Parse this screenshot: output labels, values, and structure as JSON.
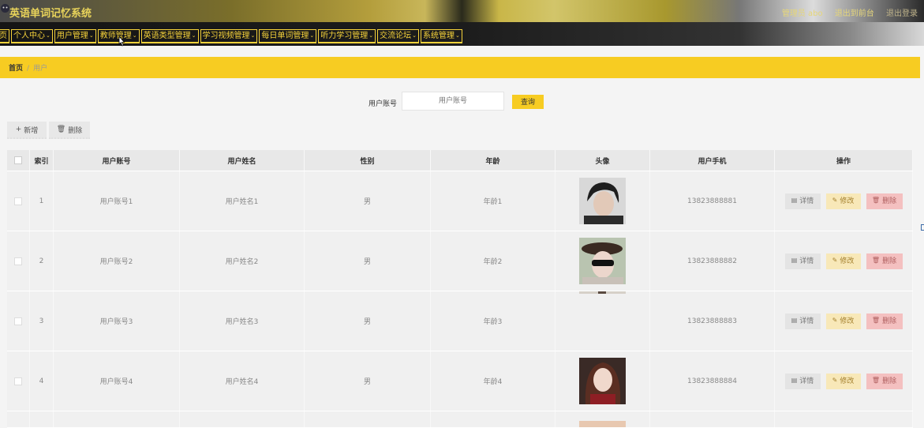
{
  "header": {
    "title": "英语单词记忆系统",
    "admin_label": "管理员 abo",
    "back_label": "退出到前台",
    "logout_label": "退出登录",
    "logo_icon": "panther-logo-icon"
  },
  "nav": {
    "items": [
      "页",
      "个人中心",
      "用户管理",
      "教师管理",
      "英语类型管理",
      "学习视频管理",
      "每日单词管理",
      "听力学习管理",
      "交流论坛",
      "系统管理"
    ],
    "caret_icon": "chevron-down-icon"
  },
  "breadcrumb": {
    "home": "首页",
    "separator": "/",
    "current": "用户"
  },
  "search": {
    "label": "用户账号",
    "placeholder": "用户账号",
    "button": "查询"
  },
  "toolbar": {
    "add": "新增",
    "delete": "删除"
  },
  "table": {
    "headers": [
      "索引",
      "用户账号",
      "用户姓名",
      "性别",
      "年龄",
      "头像",
      "用户手机",
      "操作"
    ],
    "rows": [
      {
        "index": "1",
        "account": "用户账号1",
        "name": "用户姓名1",
        "sex": "男",
        "age": "年龄1",
        "phone": "13823888881"
      },
      {
        "index": "2",
        "account": "用户账号2",
        "name": "用户姓名2",
        "sex": "男",
        "age": "年龄2",
        "phone": "13823888882"
      },
      {
        "index": "3",
        "account": "用户账号3",
        "name": "用户姓名3",
        "sex": "男",
        "age": "年龄3",
        "phone": "13823888883"
      },
      {
        "index": "4",
        "account": "用户账号4",
        "name": "用户姓名4",
        "sex": "男",
        "age": "年龄4",
        "phone": "13823888884"
      }
    ],
    "row_actions": {
      "detail": "详情",
      "edit": "修改",
      "delete": "删除"
    }
  },
  "colors": {
    "accent": "#f7cc22",
    "nav_bg": "#151515",
    "edit_bg": "#f8e8b8",
    "delete_bg": "#f4c0c0"
  }
}
